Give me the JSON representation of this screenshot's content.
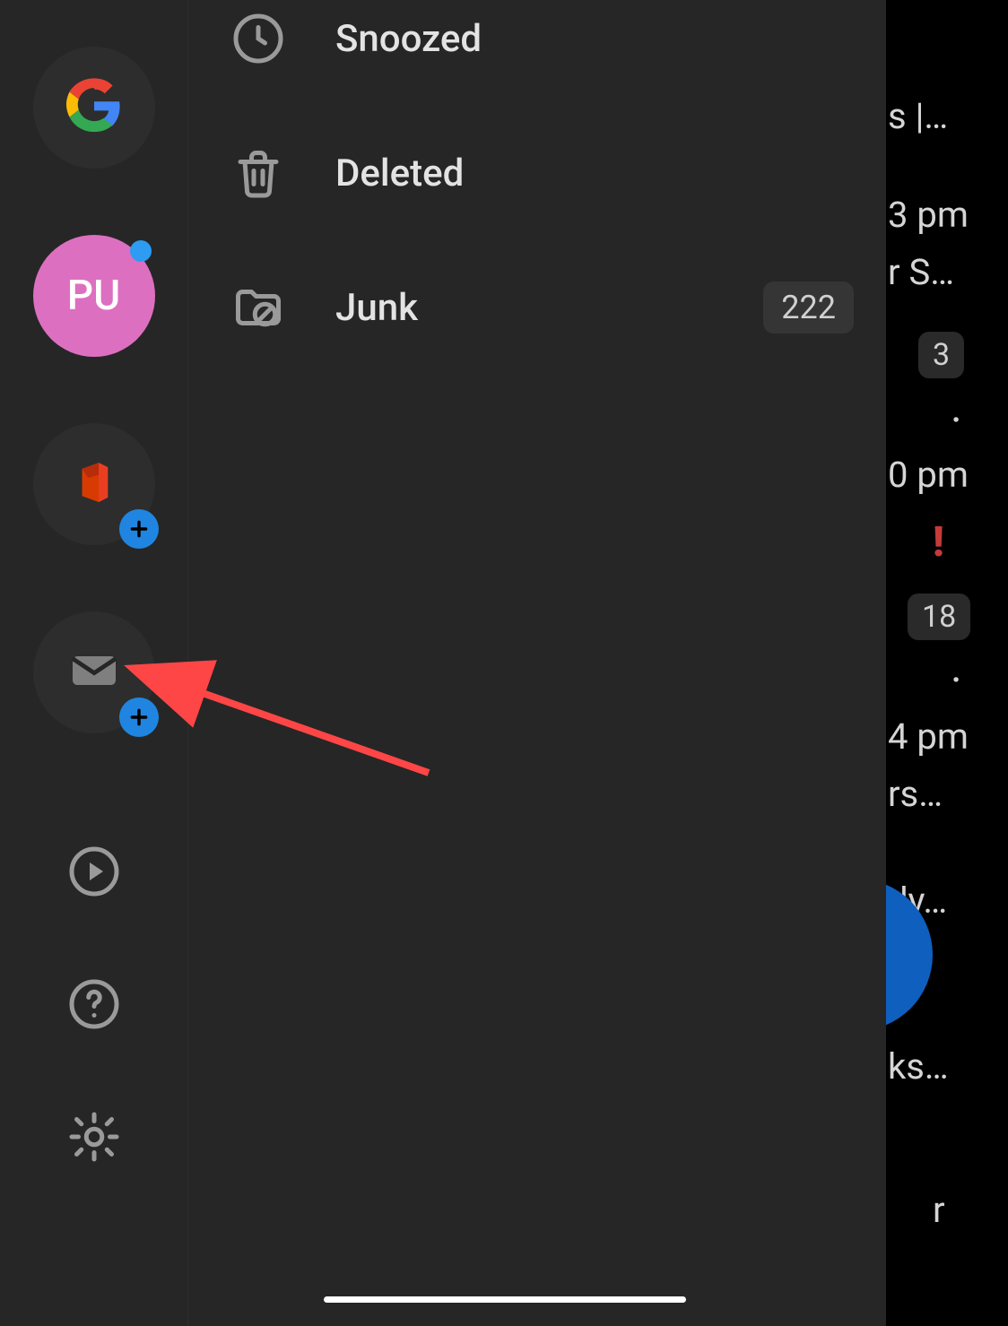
{
  "rail": {
    "pu_initials": "PU"
  },
  "folders": {
    "snoozed": {
      "label": "Snoozed"
    },
    "deleted": {
      "label": "Deleted"
    },
    "junk": {
      "label": "Junk",
      "count": "222"
    }
  },
  "bg": {
    "snip1": "s |…",
    "time1": "3 pm",
    "snip2": "r S…",
    "badge1": "3",
    "snip3": ".",
    "time2": "0 pm",
    "badge2": "18",
    "snip4": ".",
    "time3": "4 pm",
    "snip5": "rs…",
    "snip6": "dy…",
    "snip7": "ks…",
    "snip8": "r"
  }
}
